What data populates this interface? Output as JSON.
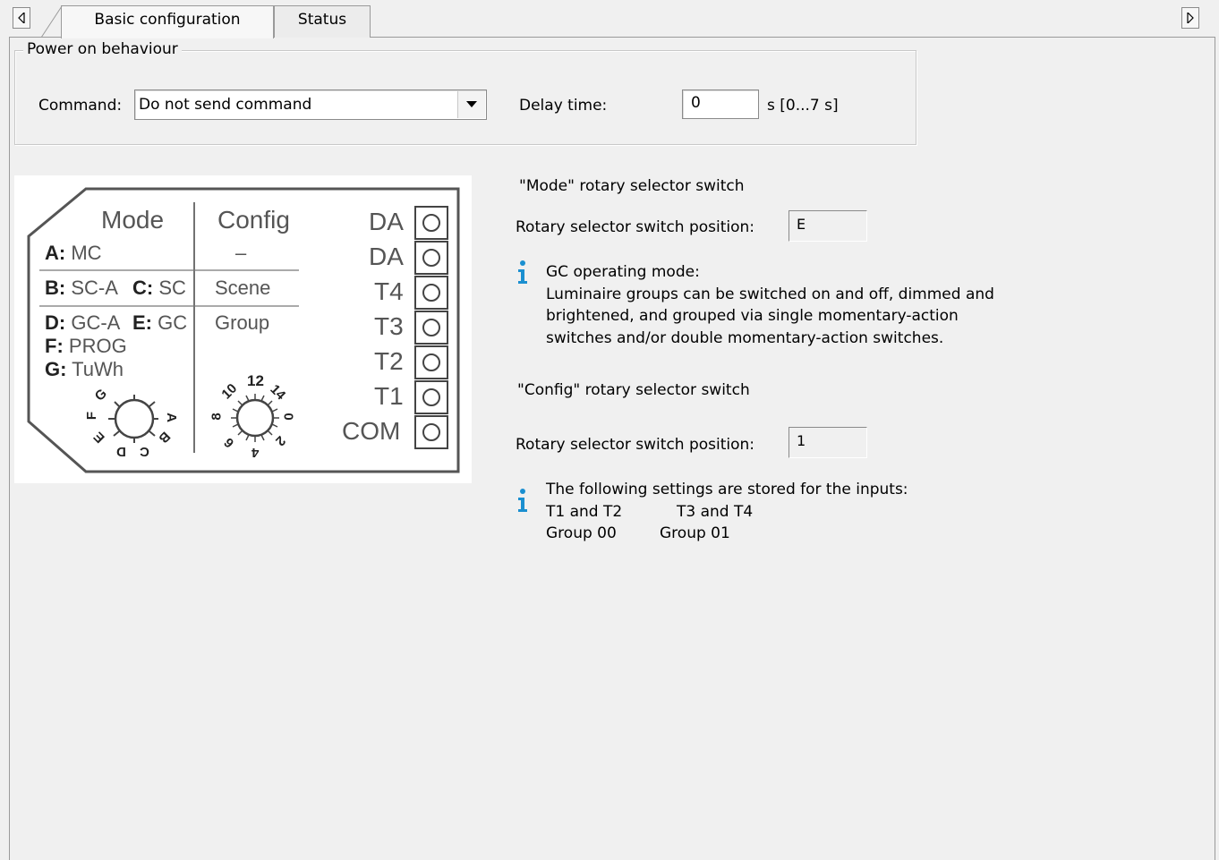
{
  "tabs": [
    {
      "label": "Basic configuration",
      "active": true
    },
    {
      "label": "Status",
      "active": false
    }
  ],
  "power_on": {
    "group_title": "Power on behaviour",
    "command_label": "Command:",
    "command_value": "Do not send command",
    "delay_label": "Delay time:",
    "delay_value": "0",
    "delay_unit": "s [0...7 s]"
  },
  "diagram": {
    "mode_header": "Mode",
    "config_header": "Config",
    "mode_rows": [
      {
        "key": "A:",
        "text": "MC"
      },
      {
        "key": "B:",
        "text": "SC-A"
      },
      {
        "key": "C:",
        "text": "SC"
      },
      {
        "key": "D:",
        "text": "GC-A"
      },
      {
        "key": "E:",
        "text": "GC"
      },
      {
        "key": "F:",
        "text": "PROG"
      },
      {
        "key": "G:",
        "text": "TuWh"
      }
    ],
    "config_rows": [
      "–",
      "Scene",
      "Group"
    ],
    "terminals": [
      "DA",
      "DA",
      "T4",
      "T3",
      "T2",
      "T1",
      "COM"
    ],
    "mode_dial_letters": [
      "G",
      "F",
      "E",
      "D",
      "C",
      "B",
      "A"
    ],
    "config_dial_numbers": [
      "12",
      "14",
      "0",
      "2",
      "4",
      "6",
      "8",
      "10"
    ]
  },
  "mode_switch": {
    "heading": "\"Mode\" rotary selector switch",
    "position_label": "Rotary selector switch position:",
    "position_value": "E",
    "info_title": "GC operating mode:",
    "info_lines": [
      "Luminaire groups can be switched on and off, dimmed and",
      "brightened, and grouped via single momentary-action",
      "switches and/or double momentary-action switches."
    ]
  },
  "config_switch": {
    "heading": "\"Config\" rotary selector switch",
    "position_label": "Rotary selector switch position:",
    "position_value": "1",
    "info_title": "The following settings are stored for the inputs:",
    "col1_head": "T1 and T2",
    "col1_value": "Group 00",
    "col2_head": "T3 and T4",
    "col2_value": "Group 01"
  },
  "colors": {
    "info_icon": "#1a8fd0",
    "background": "#f0f0f0"
  },
  "icons": [
    "scroll-left-icon",
    "scroll-right-icon",
    "dropdown-arrow-icon",
    "info-icon"
  ]
}
